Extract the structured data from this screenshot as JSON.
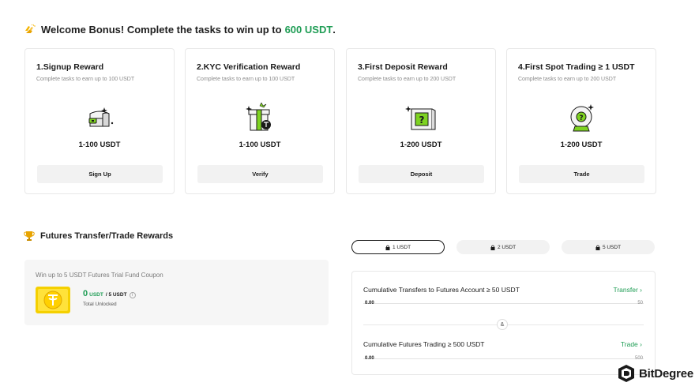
{
  "welcome": {
    "text": "Welcome Bonus! Complete the tasks to win up to",
    "amount": "600 USDT",
    "period": "."
  },
  "cards": [
    {
      "title": "1.Signup Reward",
      "subtitle": "Complete tasks to earn up to 100 USDT",
      "amount": "1-100 USDT",
      "button": "Sign Up",
      "icon": "treasure-chest-icon"
    },
    {
      "title": "2.KYC Verification Reward",
      "subtitle": "Complete tasks to earn up to 100 USDT",
      "amount": "1-100 USDT",
      "button": "Verify",
      "icon": "gift-box-icon"
    },
    {
      "title": "3.First Deposit Reward",
      "subtitle": "Complete tasks to earn up to 200 USDT",
      "amount": "1-200 USDT",
      "button": "Deposit",
      "icon": "mystery-box-icon"
    },
    {
      "title": "4.First Spot Trading ≥ 1 USDT",
      "subtitle": "Complete tasks to earn up to 200 USDT",
      "amount": "1-200 USDT",
      "button": "Trade",
      "icon": "crystal-ball-icon"
    }
  ],
  "futures": {
    "title": "Futures Transfer/Trade Rewards",
    "coupon_title": "Win up to 5 USDT Futures Trial Fund Coupon",
    "unlocked_amount": "0",
    "unlocked_unit": "USDT",
    "total_amount": "/ 5 USDT",
    "unlocked_label": "Total Unlocked",
    "tiers": [
      "1 USDT",
      "2 USDT",
      "5 USDT"
    ],
    "active_tier": 0,
    "tasks": [
      {
        "title": "Cumulative Transfers to Futures Account ≥ 50 USDT",
        "link": "Transfer",
        "start": "0.00",
        "end": "50",
        "progress": 0
      },
      {
        "title": "Cumulative Futures Trading ≥ 500 USDT",
        "link": "Trade",
        "start": "0.00",
        "end": "500",
        "progress": 0
      }
    ],
    "connector": "&"
  },
  "brand": {
    "name": "BitDegree"
  },
  "colors": {
    "accent": "#1f9d55",
    "card_border": "#e8e8e8",
    "button_bg": "#f2f2f2",
    "coin_yellow": "#f5d000"
  }
}
